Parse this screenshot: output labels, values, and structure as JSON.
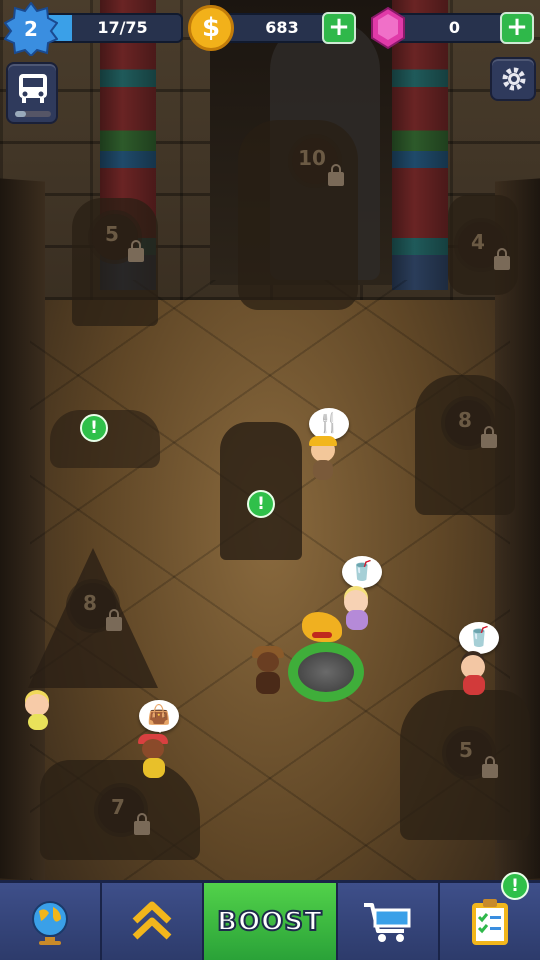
{
  "hud": {
    "level": "2",
    "xp_text": "17/75",
    "xp_progress": 0.2267,
    "coins": "683",
    "gems": "0",
    "xp_color": "#3aa0e8",
    "coin_color": "#f2b11a",
    "gem_color": "#e03aa8",
    "plus_symbol": "+"
  },
  "side_buttons": {
    "bus_icon": "bus-icon",
    "settings_icon": "gear-icon"
  },
  "locked_exhibits": [
    {
      "id": "exhibit-top-center",
      "level": "10"
    },
    {
      "id": "exhibit-left-top",
      "level": "5"
    },
    {
      "id": "exhibit-right-top",
      "level": "4"
    },
    {
      "id": "exhibit-right-middle",
      "level": "8"
    },
    {
      "id": "exhibit-left-middle",
      "level": "8"
    },
    {
      "id": "exhibit-bottom-right",
      "level": "5"
    },
    {
      "id": "exhibit-bottom-left",
      "level": "7"
    }
  ],
  "alerts": {
    "symbol": "!"
  },
  "bubbles": {
    "food_icon": "fork-knife-icon",
    "drink_icon": "drink-cup-icon",
    "shop_icon": "shopping-bag-icon"
  },
  "bottom_nav": {
    "items": [
      {
        "name": "world",
        "icon": "globe-icon"
      },
      {
        "name": "upgrade",
        "icon": "double-chevron-up-icon"
      },
      {
        "name": "boost",
        "label": "BOOST"
      },
      {
        "name": "shop",
        "icon": "shopping-cart-icon"
      },
      {
        "name": "tasks",
        "icon": "clipboard-checklist-icon"
      }
    ],
    "tasks_alert": "!"
  }
}
